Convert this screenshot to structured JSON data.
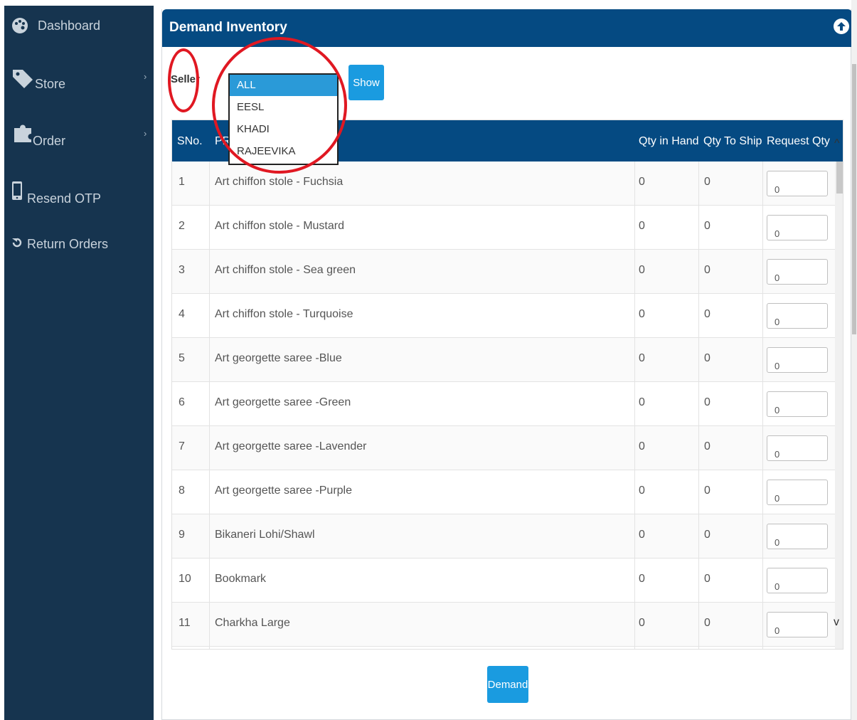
{
  "sidebar": {
    "items": [
      {
        "label": "Dashboard",
        "icon": "palette-icon",
        "has_submenu": false
      },
      {
        "label": "Store",
        "icon": "tag-icon",
        "has_submenu": true
      },
      {
        "label": "Order",
        "icon": "puzzle-icon",
        "has_submenu": true
      },
      {
        "label": "Resend OTP",
        "icon": "mobile-icon",
        "has_submenu": false
      },
      {
        "label": "Return Orders",
        "icon": "undo-icon",
        "has_submenu": false
      }
    ],
    "submenu_glyph": "›"
  },
  "panel": {
    "title": "Demand Inventory",
    "collapse_icon": "arrow-up-circle-icon"
  },
  "filter": {
    "seller_label": "Seller",
    "options": [
      "ALL",
      "EESL",
      "KHADI",
      "RAJEEVIKA"
    ],
    "selected": "ALL",
    "show_label": "Show"
  },
  "table": {
    "columns": [
      "SNo.",
      "PRODUCT",
      "Qty in Hand",
      "Qty To Ship",
      "Request Qty"
    ],
    "rows": [
      {
        "sno": "1",
        "product": "Art chiffon stole - Fuchsia",
        "qty_in_hand": "0",
        "qty_to_ship": "0",
        "request_qty": "0"
      },
      {
        "sno": "2",
        "product": "Art chiffon stole - Mustard",
        "qty_in_hand": "0",
        "qty_to_ship": "0",
        "request_qty": "0"
      },
      {
        "sno": "3",
        "product": "Art chiffon stole - Sea green",
        "qty_in_hand": "0",
        "qty_to_ship": "0",
        "request_qty": "0"
      },
      {
        "sno": "4",
        "product": "Art chiffon stole - Turquoise",
        "qty_in_hand": "0",
        "qty_to_ship": "0",
        "request_qty": "0"
      },
      {
        "sno": "5",
        "product": "Art georgette saree -Blue",
        "qty_in_hand": "0",
        "qty_to_ship": "0",
        "request_qty": "0"
      },
      {
        "sno": "6",
        "product": "Art georgette saree -Green",
        "qty_in_hand": "0",
        "qty_to_ship": "0",
        "request_qty": "0"
      },
      {
        "sno": "7",
        "product": "Art georgette saree -Lavender",
        "qty_in_hand": "0",
        "qty_to_ship": "0",
        "request_qty": "0"
      },
      {
        "sno": "8",
        "product": "Art georgette saree -Purple",
        "qty_in_hand": "0",
        "qty_to_ship": "0",
        "request_qty": "0"
      },
      {
        "sno": "9",
        "product": "Bikaneri Lohi/Shawl",
        "qty_in_hand": "0",
        "qty_to_ship": "0",
        "request_qty": "0"
      },
      {
        "sno": "10",
        "product": "Bookmark",
        "qty_in_hand": "0",
        "qty_to_ship": "0",
        "request_qty": "0"
      },
      {
        "sno": "11",
        "product": "Charkha Large",
        "qty_in_hand": "0",
        "qty_to_ship": "0",
        "request_qty": "0"
      }
    ],
    "scroll_up_glyph": "^",
    "scroll_down_glyph": "v"
  },
  "actions": {
    "demand_label": "Demand"
  },
  "colors": {
    "sidebar_bg": "#16344f",
    "header_bg": "#054a82",
    "button_bg": "#1a9be0",
    "selected_option_bg": "#2a9ad8",
    "annotation_red": "#e01822"
  }
}
